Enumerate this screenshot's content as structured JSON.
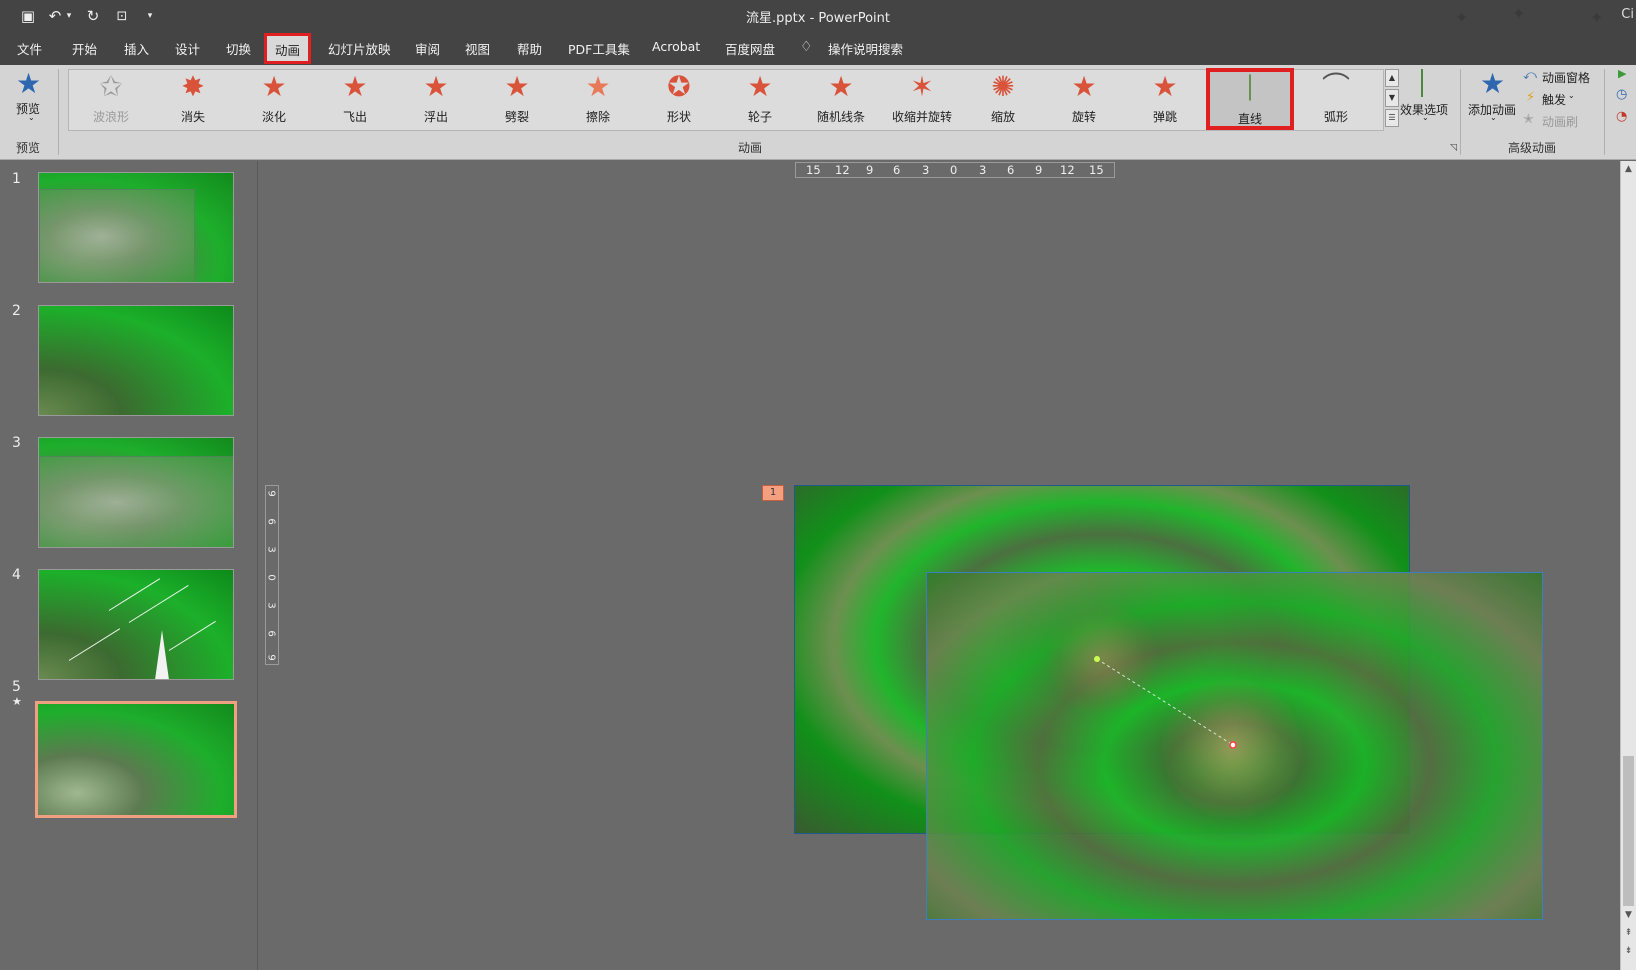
{
  "title_bar": {
    "document_title": "流星.pptx  -  PowerPoint",
    "corner_text": "Ci",
    "quick_access": [
      {
        "name": "save-icon",
        "glyph": "🖫"
      },
      {
        "name": "undo-icon",
        "glyph": "↶"
      },
      {
        "name": "undo-dropdown-icon",
        "glyph": "⌄"
      },
      {
        "name": "redo-icon",
        "glyph": "↻"
      },
      {
        "name": "present-icon",
        "glyph": "⌼"
      },
      {
        "name": "customize-qat-icon",
        "glyph": "⩡"
      }
    ]
  },
  "menu": {
    "items": [
      "文件",
      "开始",
      "插入",
      "设计",
      "切换",
      "动画",
      "幻灯片放映",
      "审阅",
      "视图",
      "帮助",
      "PDF工具集",
      "Acrobat",
      "百度网盘",
      "操作说明搜索"
    ],
    "active": "动画",
    "highlight_color": "#e02020"
  },
  "ribbon": {
    "preview": {
      "label": "预览",
      "group_label": "预览"
    },
    "animation_group_label": "动画",
    "effects": [
      {
        "label": "波浪形",
        "glyph": "✩",
        "disabled": true
      },
      {
        "label": "消失",
        "glyph": "✸",
        "disabled": false
      },
      {
        "label": "淡化",
        "glyph": "★",
        "disabled": false
      },
      {
        "label": "飞出",
        "glyph": "★",
        "disabled": false
      },
      {
        "label": "浮出",
        "glyph": "★",
        "disabled": false
      },
      {
        "label": "劈裂",
        "glyph": "★",
        "disabled": false
      },
      {
        "label": "擦除",
        "glyph": "★",
        "disabled": false
      },
      {
        "label": "形状",
        "glyph": "✪",
        "disabled": false
      },
      {
        "label": "轮子",
        "glyph": "★",
        "disabled": false
      },
      {
        "label": "随机线条",
        "glyph": "★",
        "disabled": false
      },
      {
        "label": "收缩并旋转",
        "glyph": "✶",
        "disabled": false
      },
      {
        "label": "缩放",
        "glyph": "✺",
        "disabled": false
      },
      {
        "label": "旋转",
        "glyph": "★",
        "disabled": false
      },
      {
        "label": "弹跳",
        "glyph": "★",
        "disabled": false
      },
      {
        "label": "直线",
        "glyph": "│",
        "disabled": false,
        "selected": true
      },
      {
        "label": "弧形",
        "glyph": "⌒",
        "disabled": false
      }
    ],
    "effect_options": "效果选项",
    "add_animation": "添加动画",
    "animation_pane": "动画窗格",
    "trigger": "触发",
    "animation_painter": "动画刷",
    "advanced_group_label": "高级动画"
  },
  "slides_panel": {
    "slides": [
      {
        "number": "1",
        "has_animation": false
      },
      {
        "number": "2",
        "has_animation": false
      },
      {
        "number": "3",
        "has_animation": false
      },
      {
        "number": "4",
        "has_animation": false
      },
      {
        "number": "5",
        "has_animation": true,
        "selected": true
      }
    ],
    "animation_marker": "★"
  },
  "canvas": {
    "horizontal_ruler": [
      "15",
      "12",
      "9",
      "6",
      "3",
      "0",
      "3",
      "6",
      "9",
      "12",
      "15"
    ],
    "vertical_ruler": [
      "9",
      "6",
      "3",
      "0",
      "3",
      "6",
      "9"
    ],
    "animation_badge": "1",
    "path_start_color": "#c8ff50",
    "path_end_color": "#ff4040"
  }
}
